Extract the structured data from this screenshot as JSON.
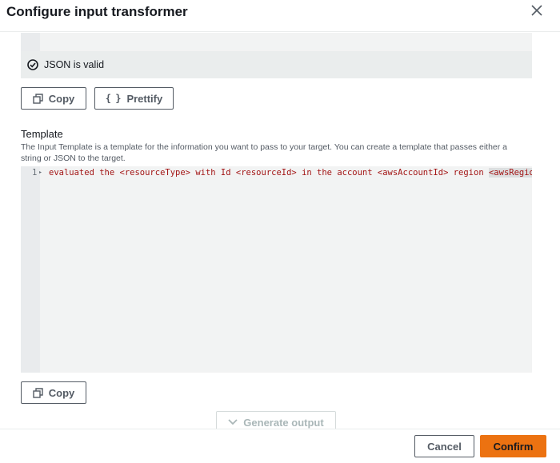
{
  "dialog": {
    "title": "Configure input transformer"
  },
  "validation": {
    "message": "JSON is valid"
  },
  "input_buttons": {
    "copy_label": "Copy",
    "prettify_label": "Prettify"
  },
  "template": {
    "label": "Template",
    "description": "The Input Template is a template for the information you want to pass to your target. You can create a template that passes either a string or JSON to the target.",
    "line_number": "1",
    "code_main": "evaluated the <resourceType> with Id <resourceId> in the account <awsAccountId> region ",
    "code_tail": "<awsRegion>",
    "copy_label": "Copy"
  },
  "generate": {
    "label": "Generate output"
  },
  "footer": {
    "cancel_label": "Cancel",
    "confirm_label": "Confirm"
  },
  "colors": {
    "primary": "#ec7211",
    "code_text": "#a31515",
    "valid_icon": "#16191f"
  }
}
